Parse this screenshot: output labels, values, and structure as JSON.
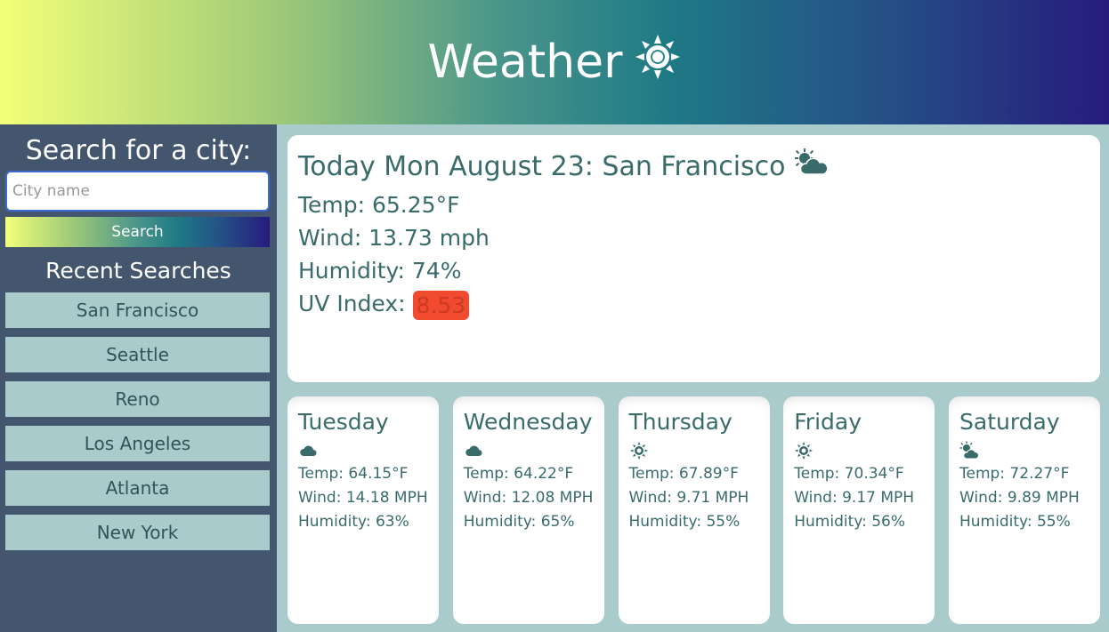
{
  "header": {
    "title": "Weather",
    "icon": "sun-icon"
  },
  "sidebar": {
    "title": "Search for a city:",
    "search_placeholder": "City name",
    "search_button": "Search",
    "recent_title": "Recent Searches",
    "recent": [
      "San Francisco",
      "Seattle",
      "Reno",
      "Los Angeles",
      "Atlanta",
      "New York"
    ]
  },
  "today": {
    "title": "Today Mon August 23: San Francisco",
    "icon": "sun-cloud-icon",
    "temp": "Temp: 65.25°F",
    "wind": "Wind: 13.73 mph",
    "humidity": "Humidity: 74%",
    "uv_label": "UV Index: ",
    "uv_value": "8.53",
    "uv_color": "#f04a2f"
  },
  "forecast": [
    {
      "day": "Tuesday",
      "icon": "cloud-icon",
      "temp": "Temp: 64.15°F",
      "wind": "Wind: 14.18 MPH",
      "humidity": "Humidity: 63%"
    },
    {
      "day": "Wednesday",
      "icon": "cloud-icon",
      "temp": "Temp: 64.22°F",
      "wind": "Wind: 12.08 MPH",
      "humidity": "Humidity: 65%"
    },
    {
      "day": "Thursday",
      "icon": "sun-icon",
      "temp": "Temp: 67.89°F",
      "wind": "Wind: 9.71 MPH",
      "humidity": "Humidity: 55%"
    },
    {
      "day": "Friday",
      "icon": "sun-icon",
      "temp": "Temp: 70.34°F",
      "wind": "Wind: 9.17 MPH",
      "humidity": "Humidity: 56%"
    },
    {
      "day": "Saturday",
      "icon": "sun-cloud-icon",
      "temp": "Temp: 72.27°F",
      "wind": "Wind: 9.89 MPH",
      "humidity": "Humidity: 55%"
    }
  ],
  "colors": {
    "accent": "#3a6b6b",
    "sidebar_bg": "#44556e",
    "page_bg": "#aacbcc"
  }
}
